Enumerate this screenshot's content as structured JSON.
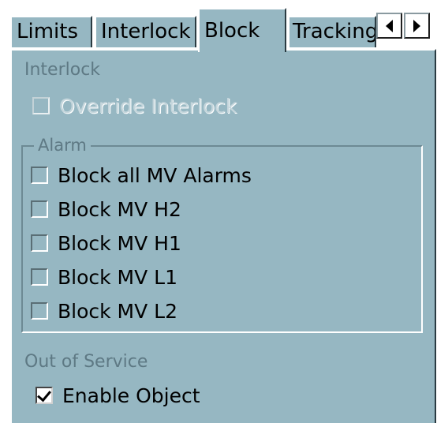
{
  "tabs": {
    "limits": "Limits",
    "interlock": "Interlock",
    "block": "Block",
    "tracking": "Tracking"
  },
  "interlock_section": {
    "title": "Interlock",
    "override": {
      "label": "Override Interlock",
      "checked": false,
      "enabled": false
    }
  },
  "alarm_group": {
    "title": "Alarm",
    "items": [
      {
        "label": "Block all MV Alarms",
        "checked": false
      },
      {
        "label": "Block MV H2",
        "checked": false
      },
      {
        "label": "Block MV H1",
        "checked": false
      },
      {
        "label": "Block MV L1",
        "checked": false
      },
      {
        "label": "Block MV L2",
        "checked": false
      }
    ]
  },
  "out_of_service": {
    "title": "Out of Service",
    "enable": {
      "label": "Enable Object",
      "checked": true
    }
  },
  "colors": {
    "panel": "#96b7c2",
    "disabled_text": "#5e7984",
    "text": "#000000"
  },
  "icons": {
    "scroll_left": "caret-left-icon",
    "scroll_right": "caret-right-icon",
    "checkmark": "checkmark-icon"
  }
}
